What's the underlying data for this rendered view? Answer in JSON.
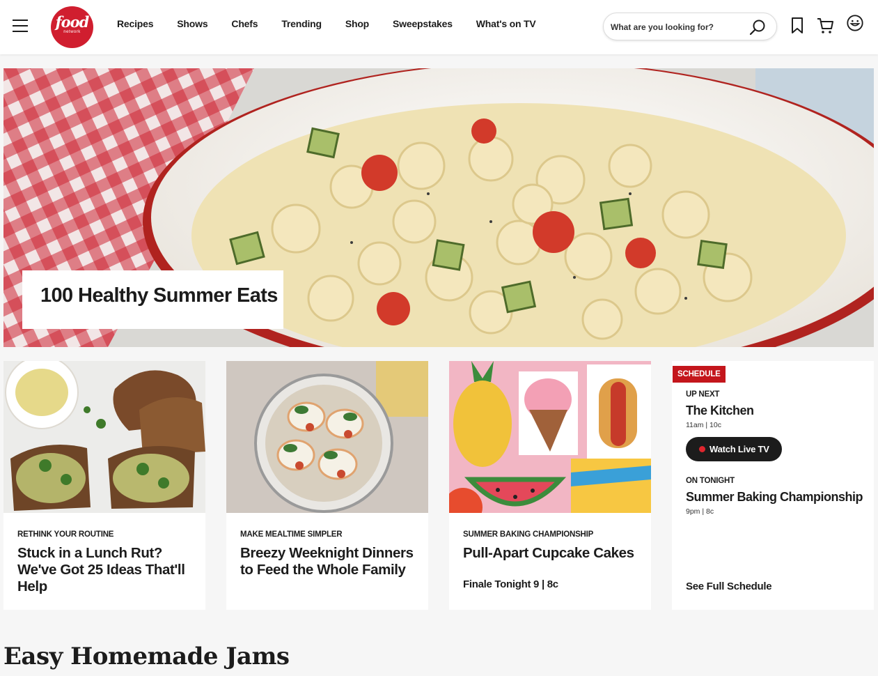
{
  "header": {
    "logo_text": "food",
    "logo_subtext": "network",
    "nav": [
      "Recipes",
      "Shows",
      "Chefs",
      "Trending",
      "Shop",
      "Sweepstakes",
      "What's on TV"
    ],
    "search_placeholder": "What are you looking for?",
    "icons": [
      "menu-icon",
      "search-icon",
      "bookmark-icon",
      "cart-icon",
      "user-icon"
    ]
  },
  "hero": {
    "title": "100 Healthy Summer Eats"
  },
  "cards": [
    {
      "kicker": "RETHINK YOUR ROUTINE",
      "title": "Stuck in a Lunch Rut? We've Got 25 Ideas That'll Help",
      "extra": ""
    },
    {
      "kicker": "MAKE MEALTIME SIMPLER",
      "title": "Breezy Weeknight Dinners to Feed the Whole Family",
      "extra": ""
    },
    {
      "kicker": "SUMMER BAKING CHAMPIONSHIP",
      "title": "Pull-Apart Cupcake Cakes",
      "extra": "Finale Tonight 9 | 8c"
    }
  ],
  "schedule": {
    "badge": "SCHEDULE",
    "up_next_label": "UP NEXT",
    "up_next_show": "The Kitchen",
    "up_next_time": "11am | 10c",
    "live_button": "Watch Live TV",
    "tonight_label": "ON TONIGHT",
    "tonight_show": "Summer Baking Championship",
    "tonight_time": "9pm | 8c",
    "full_schedule_link": "See Full Schedule"
  },
  "section": {
    "title": "Easy Homemade Jams"
  },
  "colors": {
    "brand_red": "#d01e2f",
    "badge_red": "#c4161c",
    "dark": "#1c1c1c",
    "page_bg": "#f6f6f6"
  }
}
